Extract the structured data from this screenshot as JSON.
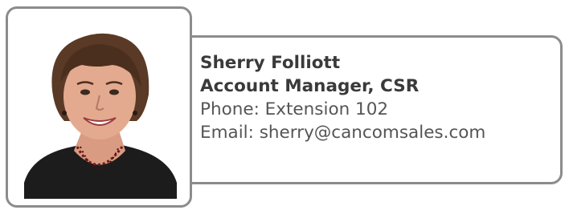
{
  "contact": {
    "name": "Sherry Folliott",
    "title": "Account Manager, CSR",
    "phone": "Phone: Extension 102",
    "email": "Email: sherry@cancomsales.com"
  },
  "photo": {
    "subject": "portrait"
  },
  "colors": {
    "frame_border": "#8c8c8c",
    "name_text": "#3a3a3a",
    "body_text": "#555555"
  }
}
